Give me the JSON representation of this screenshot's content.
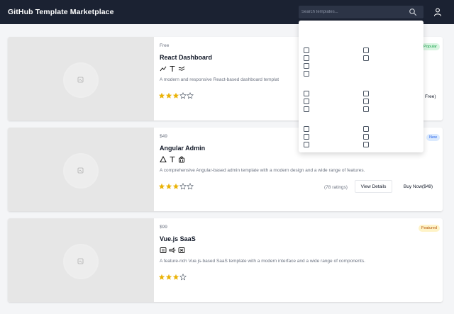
{
  "header": {
    "title": "GitHub Template Marketplace",
    "search_placeholder": "Search templates..."
  },
  "cards": [
    {
      "price": "Free",
      "title": "React Dashboard",
      "description": "A modern and responsive React-based dashboard templat",
      "badge": "Popular",
      "rating": 3,
      "max_rating": 5,
      "tech_icons": [
        "chart-line-icon",
        "typescript-icon",
        "tailwind-icon"
      ],
      "buy_label_visible": "Free)"
    },
    {
      "price": "$49",
      "title": "Angular Admin",
      "description": "A comprehensive Angular-based admin template with a modern design and a wide range of features.",
      "badge": "New",
      "rating": 3,
      "max_rating": 5,
      "tech_icons": [
        "angular-icon",
        "typescript-icon",
        "material-icon"
      ],
      "ratings_count": "(78 ratings)",
      "view_details": "View Details",
      "buy_label": "Buy Now($49)"
    },
    {
      "price": "$99",
      "title": "Vue.js SaaS",
      "description": "A feature-rich Vue.js-based SaaS template with a modern interface and a wide range of components.",
      "badge": "Featured",
      "rating": 3,
      "max_rating": 5,
      "tech_icons": [
        "vue-icon",
        "vuetify-icon",
        "nuxt-icon"
      ]
    }
  ],
  "filter_dropdown": {
    "checkboxes_column_1": 10,
    "checkboxes_column_2": 8
  },
  "colors": {
    "header_bg": "#1b2232",
    "star": "#eab308",
    "popular": "#16a34a",
    "new": "#2563eb",
    "featured": "#b45309"
  }
}
